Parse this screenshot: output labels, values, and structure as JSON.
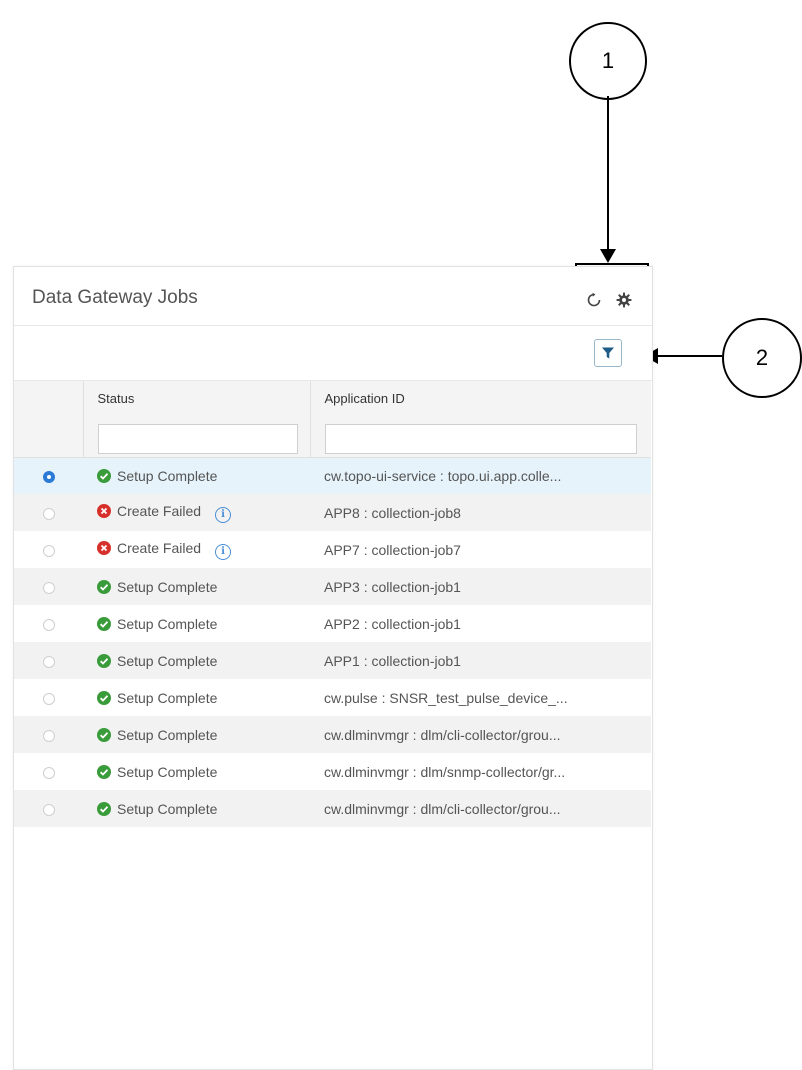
{
  "callouts": {
    "one": "1",
    "two": "2"
  },
  "panel": {
    "title": "Data Gateway Jobs",
    "icons": {
      "refresh": "refresh-icon",
      "settings": "gear-icon",
      "filter": "filter-icon"
    }
  },
  "table": {
    "headers": {
      "status": "Status",
      "app_id": "Application ID"
    },
    "rows": [
      {
        "status": "Setup Complete",
        "ok": true,
        "app_id": "cw.topo-ui-service : topo.ui.app.colle...",
        "selected": true
      },
      {
        "status": "Create Failed",
        "ok": false,
        "app_id": "APP8 : collection-job8",
        "selected": false
      },
      {
        "status": "Create Failed",
        "ok": false,
        "app_id": "APP7 : collection-job7",
        "selected": false
      },
      {
        "status": "Setup Complete",
        "ok": true,
        "app_id": "APP3 : collection-job1",
        "selected": false
      },
      {
        "status": "Setup Complete",
        "ok": true,
        "app_id": "APP2 : collection-job1",
        "selected": false
      },
      {
        "status": "Setup Complete",
        "ok": true,
        "app_id": "APP1 : collection-job1",
        "selected": false
      },
      {
        "status": "Setup Complete",
        "ok": true,
        "app_id": "cw.pulse : SNSR_test_pulse_device_...",
        "selected": false
      },
      {
        "status": "Setup Complete",
        "ok": true,
        "app_id": "cw.dlminvmgr : dlm/cli-collector/grou...",
        "selected": false
      },
      {
        "status": "Setup Complete",
        "ok": true,
        "app_id": "cw.dlminvmgr : dlm/snmp-collector/gr...",
        "selected": false
      },
      {
        "status": "Setup Complete",
        "ok": true,
        "app_id": "cw.dlminvmgr : dlm/cli-collector/grou...",
        "selected": false
      }
    ]
  },
  "colors": {
    "selected_row": "#e6f3fb",
    "radio_on": "#2a7ad6",
    "ok": "#3a9b3a",
    "fail": "#d7302a",
    "info": "#4a8fd6"
  }
}
